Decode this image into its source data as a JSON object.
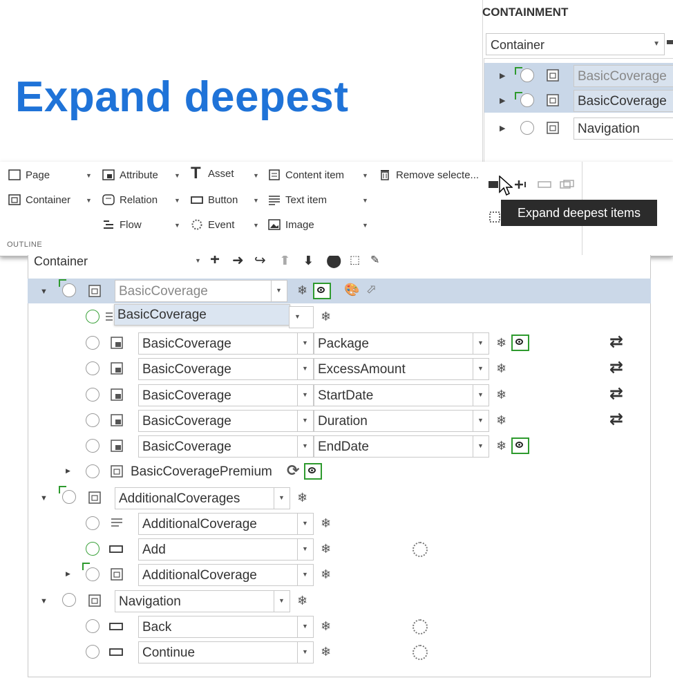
{
  "title": "Expand deepest",
  "containment": {
    "heading": "CONTAINMENT",
    "select": "Container",
    "rows": [
      {
        "label": "BasicCoverage"
      },
      {
        "label": "BasicCoverage"
      },
      {
        "label": "Navigation"
      }
    ]
  },
  "ribbon": {
    "group_label": "OUTLINE",
    "items": {
      "page": "Page",
      "container": "Container",
      "attribute": "Attribute",
      "relation": "Relation",
      "flow": "Flow",
      "asset": "Asset",
      "button": "Button",
      "event": "Event",
      "content_item": "Content item",
      "text_item": "Text item",
      "image": "Image",
      "remove": "Remove selecte..."
    }
  },
  "tooltip": "Expand deepest items",
  "tree": {
    "select": "Container",
    "popup": "BasicCoverage",
    "rows": [
      {
        "field1": "BasicCoverage"
      },
      {
        "field1": ""
      },
      {
        "field1": "BasicCoverage",
        "field2": "Package"
      },
      {
        "field1": "BasicCoverage",
        "field2": "ExcessAmount"
      },
      {
        "field1": "BasicCoverage",
        "field2": "StartDate"
      },
      {
        "field1": "BasicCoverage",
        "field2": "Duration"
      },
      {
        "field1": "BasicCoverage",
        "field2": "EndDate"
      },
      {
        "field1": "BasicCoveragePremium"
      },
      {
        "field1": "AdditionalCoverages"
      },
      {
        "field1": "AdditionalCoverage"
      },
      {
        "field1": "Add"
      },
      {
        "field1": "AdditionalCoverage"
      },
      {
        "field1": "Navigation"
      },
      {
        "field1": "Back"
      },
      {
        "field1": "Continue"
      }
    ]
  }
}
